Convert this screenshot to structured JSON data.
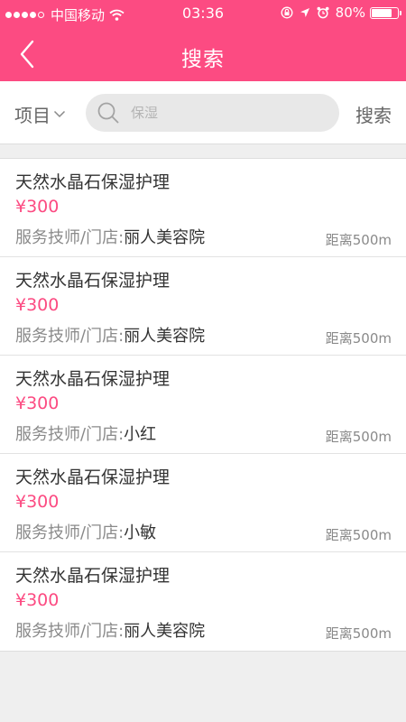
{
  "status_bar": {
    "carrier": "中国移动",
    "time": "03:36",
    "battery": "80%",
    "battery_level": 0.8
  },
  "header": {
    "title": "搜索",
    "back_icon": "chevron-left-icon"
  },
  "search": {
    "category_label": "项目",
    "placeholder": "保湿",
    "value": "",
    "button_label": "搜索"
  },
  "results": [
    {
      "title": "天然水晶石保湿护理",
      "price": "¥300",
      "provider_label": "服务技师/门店:",
      "provider_name": "丽人美容院",
      "distance": "距离500m"
    },
    {
      "title": "天然水晶石保湿护理",
      "price": "¥300",
      "provider_label": "服务技师/门店:",
      "provider_name": "丽人美容院",
      "distance": "距离500m"
    },
    {
      "title": "天然水晶石保湿护理",
      "price": "¥300",
      "provider_label": "服务技师/门店:",
      "provider_name": "小红",
      "distance": "距离500m"
    },
    {
      "title": "天然水晶石保湿护理",
      "price": "¥300",
      "provider_label": "服务技师/门店:",
      "provider_name": "小敏",
      "distance": "距离500m"
    },
    {
      "title": "天然水晶石保湿护理",
      "price": "¥300",
      "provider_label": "服务技师/门店:",
      "provider_name": "丽人美容院",
      "distance": "距离500m"
    }
  ],
  "colors": {
    "accent": "#fc4b82",
    "background": "#efefef",
    "text_primary": "#333333",
    "text_secondary": "#8a8a8a"
  }
}
